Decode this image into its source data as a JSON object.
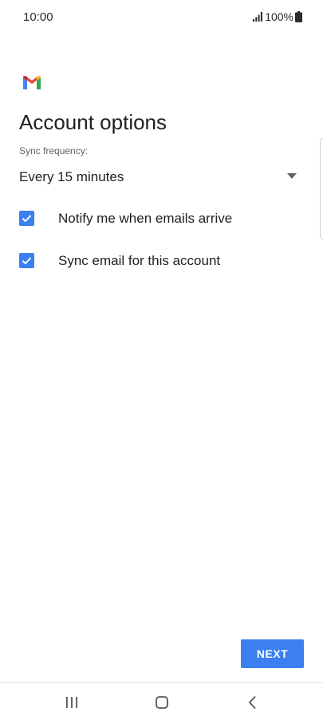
{
  "status_bar": {
    "time": "10:00",
    "battery_text": "100%",
    "icons": [
      "signal-icon",
      "battery-icon"
    ]
  },
  "app": {
    "logo_icon": "gmail-logo-icon",
    "colors": {
      "red": "#ea4335",
      "blue": "#4285f4",
      "green": "#34a853",
      "yellow": "#fbbc05",
      "accent": "#3c7ff0"
    }
  },
  "page": {
    "title": "Account options"
  },
  "sync": {
    "label": "Sync frequency:",
    "selected": "Every 15 minutes"
  },
  "options": [
    {
      "label": "Notify me when emails arrive",
      "checked": true
    },
    {
      "label": "Sync email for this account",
      "checked": true
    }
  ],
  "actions": {
    "next_label": "NEXT"
  },
  "nav_bar": {
    "icons": [
      "recents-icon",
      "home-icon",
      "back-icon"
    ]
  }
}
